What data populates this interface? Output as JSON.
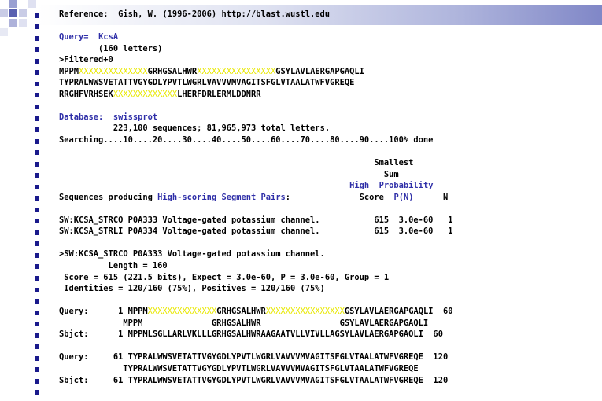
{
  "reference": "Reference:  Gish, W. (1996-2006) http://blast.wustl.edu",
  "query": {
    "label": "Query=",
    "name": "KcsA",
    "letters": "(160 letters)",
    "filtered": ">Filtered+0",
    "seq": [
      {
        "a": "MPPM",
        "x": "XXXXXXXXXXXXXX",
        "b": "GRHGSALHWR",
        "x2": "XXXXXXXXXXXXXXXX",
        "c": "GSYLAVLAERGAPGAQLI"
      },
      {
        "a": "TYPRALWWSVETATTVGYGDLYPVTLWGRLVAVVVMVAGITSFGLVTAALATWFVGREQE"
      },
      {
        "a": "RRGHFVRHSEK",
        "x": "XXXXXXXXXXXXX",
        "b": "LHERFDRLERMLDDNRR"
      }
    ]
  },
  "database": {
    "label": "Database:",
    "name": "swissprot",
    "stats": "223,100 sequences; 81,965,973 total letters.",
    "searching": "Searching....10....20....30....40....50....60....70....80....90....100% done"
  },
  "table": {
    "head1": "Smallest",
    "head2": "Sum",
    "high": "High",
    "probability": "Probability",
    "seq_label": "Sequences producing",
    "seq_hl": "High-scoring Segment Pairs",
    "colon": ":",
    "score": "Score",
    "pn": "P(N)",
    "n": "N",
    "rows": [
      "SW:KCSA_STRCO P0A333 Voltage-gated potassium channel.           615  3.0e-60   1",
      "SW:KCSA_STRLI P0A334 Voltage-gated potassium channel.           615  3.0e-60   1"
    ]
  },
  "hit": {
    "title": ">SW:KCSA_STRCO P0A333 Voltage-gated potassium channel.",
    "length": "Length = 160",
    "score": "Score = 615 (221.5 bits), Expect = 3.0e-60, P = 3.0e-60, Group = 1",
    "identities": "Identities = 120/160 (75%), Positives = 120/160 (75%)"
  },
  "alignment": {
    "q1_prefix": "Query:      1 ",
    "q1_a": "MPPM",
    "q1_x": "XXXXXXXXXXXXXX",
    "q1_b": "GRHGSALHWR",
    "q1_x2": "XXXXXXXXXXXXXXXX",
    "q1_c": "GSYLAVLAERGAPGAQLI  60",
    "m1": "             MPPM              GRHGSALHWR                GSYLAVLAERGAPGAQLI",
    "s1": "Sbjct:      1 MPPMLSGLLARLVKLLLGRHGSALHWRAAGAATVLLVIVLLAGSYLAVLAERGAPGAQLI  60",
    "q2": "Query:     61 TYPRALWWSVETATTVGYGDLYPVTLWGRLVAVVVMVAGITSFGLVTAALATWFVGREQE  120",
    "m2": "             TYPRALWWSVETATTVGYGDLYPVTLWGRLVAVVVMVAGITSFGLVTAALATWFVGREQE",
    "s2": "Sbjct:     61 TYPRALWWSVETATTVGYGDLYPVTLWGRLVAVVVMVAGITSFGLVTAALATWFVGREQE  120"
  }
}
